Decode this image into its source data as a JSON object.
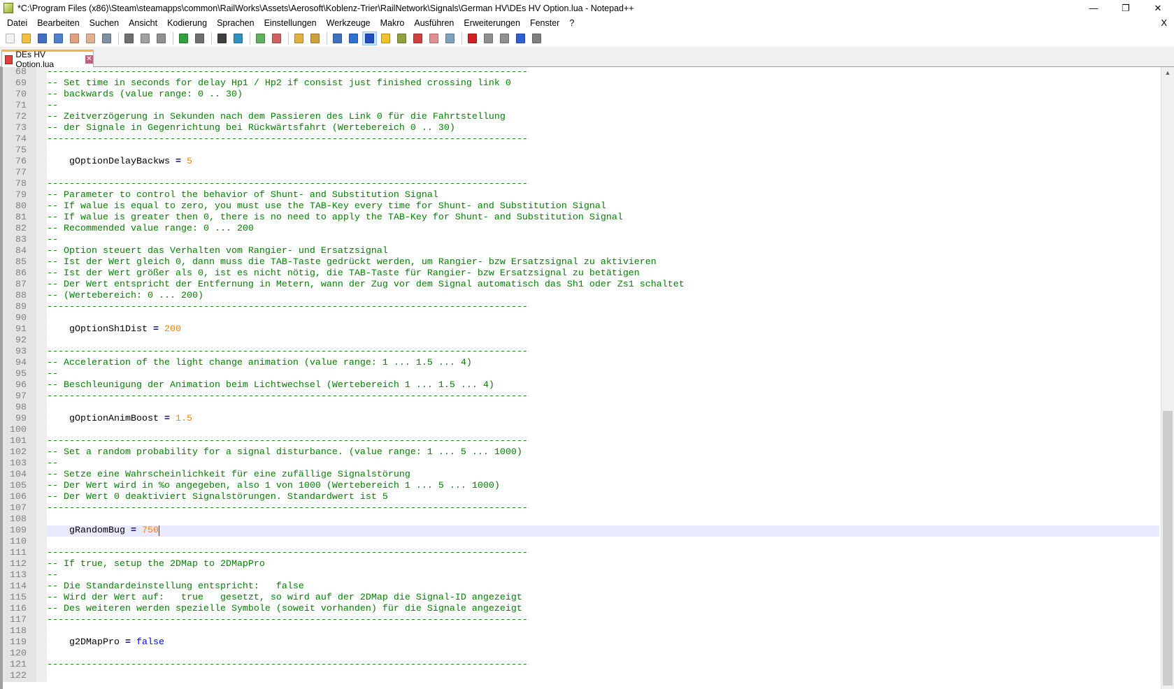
{
  "window": {
    "title": "*C:\\Program Files (x86)\\Steam\\steamapps\\common\\RailWorks\\Assets\\Aerosoft\\Koblenz-Trier\\RailNetwork\\Signals\\German HV\\DEs HV Option.lua - Notepad++",
    "minimize": "—",
    "restore": "❐",
    "close": "✕"
  },
  "menu": [
    "Datei",
    "Bearbeiten",
    "Suchen",
    "Ansicht",
    "Kodierung",
    "Sprachen",
    "Einstellungen",
    "Werkzeuge",
    "Makro",
    "Ausführen",
    "Erweiterungen",
    "Fenster",
    "?"
  ],
  "menu_close": "X",
  "toolbar": [
    {
      "icon": "new-file-icon",
      "color": "#f4f4f4"
    },
    {
      "icon": "open-file-icon",
      "color": "#f0c040"
    },
    {
      "icon": "save-icon",
      "color": "#4070c0"
    },
    {
      "icon": "save-all-icon",
      "color": "#5080d0"
    },
    {
      "icon": "close-icon",
      "color": "#e0a080"
    },
    {
      "icon": "close-all-icon",
      "color": "#e0b090"
    },
    {
      "icon": "print-icon",
      "color": "#8090a0"
    },
    {
      "sep": true
    },
    {
      "icon": "cut-icon",
      "color": "#707070"
    },
    {
      "icon": "copy-icon",
      "color": "#a0a0a0"
    },
    {
      "icon": "paste-icon",
      "color": "#909090"
    },
    {
      "sep": true
    },
    {
      "icon": "undo-icon",
      "color": "#30a040"
    },
    {
      "icon": "redo-icon",
      "color": "#707070"
    },
    {
      "sep": true
    },
    {
      "icon": "find-icon",
      "color": "#404040"
    },
    {
      "icon": "replace-icon",
      "color": "#3090c0"
    },
    {
      "sep": true
    },
    {
      "icon": "zoom-in-icon",
      "color": "#60b060"
    },
    {
      "icon": "zoom-out-icon",
      "color": "#d06060"
    },
    {
      "sep": true
    },
    {
      "icon": "sync-vertical-icon",
      "color": "#e0b040"
    },
    {
      "icon": "sync-horizontal-icon",
      "color": "#d0a040"
    },
    {
      "sep": true
    },
    {
      "icon": "word-wrap-icon",
      "color": "#4070c0"
    },
    {
      "icon": "show-all-chars-icon",
      "color": "#3070d0"
    },
    {
      "icon": "indent-guide-icon",
      "color": "#2050c0",
      "active": true
    },
    {
      "icon": "udl-icon",
      "color": "#f0c030"
    },
    {
      "icon": "doc-map-icon",
      "color": "#90a040"
    },
    {
      "icon": "function-list-icon",
      "color": "#d04040"
    },
    {
      "icon": "folder-workspace-icon",
      "color": "#e09090"
    },
    {
      "icon": "monitoring-icon",
      "color": "#80a0c0"
    },
    {
      "sep": true
    },
    {
      "icon": "record-macro-icon",
      "color": "#d02020"
    },
    {
      "icon": "stop-macro-icon",
      "color": "#909090"
    },
    {
      "icon": "play-macro-icon",
      "color": "#909090"
    },
    {
      "icon": "run-macro-multiple-icon",
      "color": "#3060d0"
    },
    {
      "icon": "save-macro-icon",
      "color": "#808080"
    }
  ],
  "tab": {
    "label": "DEs HV Option.lua",
    "close": "✕"
  },
  "colors": {
    "comment": "#008000",
    "number": "#ff8000",
    "keyword": "#0000ff",
    "current_line": "#e8e8ff"
  },
  "lines": [
    {
      "n": "68",
      "s": [
        [
          "comment",
          "--------------------------------------------------------------------------------------"
        ]
      ]
    },
    {
      "n": "69",
      "s": [
        [
          "comment",
          "-- Set time in seconds for delay Hp1 / Hp2 if consist just finished crossing link 0"
        ]
      ]
    },
    {
      "n": "70",
      "s": [
        [
          "comment",
          "-- backwards (value range: 0 .. 30)"
        ]
      ]
    },
    {
      "n": "71",
      "s": [
        [
          "comment",
          "--"
        ]
      ]
    },
    {
      "n": "72",
      "s": [
        [
          "comment",
          "-- Zeitverzögerung in Sekunden nach dem Passieren des Link 0 für die Fahrtstellung"
        ]
      ]
    },
    {
      "n": "73",
      "s": [
        [
          "comment",
          "-- der Signale in Gegenrichtung bei Rückwärtsfahrt (Wertebereich 0 .. 30)"
        ]
      ]
    },
    {
      "n": "74",
      "s": [
        [
          "comment",
          "--------------------------------------------------------------------------------------"
        ]
      ]
    },
    {
      "n": "75",
      "s": []
    },
    {
      "n": "76",
      "s": [
        [
          "plain",
          "    gOptionDelayBackws "
        ],
        [
          "op",
          "="
        ],
        [
          "plain",
          " "
        ],
        [
          "num",
          "5"
        ]
      ]
    },
    {
      "n": "77",
      "s": []
    },
    {
      "n": "78",
      "s": [
        [
          "comment",
          "--------------------------------------------------------------------------------------"
        ]
      ]
    },
    {
      "n": "79",
      "s": [
        [
          "comment",
          "-- Parameter to control the behavior of Shunt- and Substitution Signal"
        ]
      ]
    },
    {
      "n": "80",
      "s": [
        [
          "comment",
          "-- If walue is equal to zero, you must use the TAB-Key every time for Shunt- and Substitution Signal"
        ]
      ]
    },
    {
      "n": "81",
      "s": [
        [
          "comment",
          "-- If walue is greater then 0, there is no need to apply the TAB-Key for Shunt- and Substitution Signal"
        ]
      ]
    },
    {
      "n": "82",
      "s": [
        [
          "comment",
          "-- Recommended value range: 0 ... 200"
        ]
      ]
    },
    {
      "n": "83",
      "s": [
        [
          "comment",
          "--"
        ]
      ]
    },
    {
      "n": "84",
      "s": [
        [
          "comment",
          "-- Option steuert das Verhalten vom Rangier- und Ersatzsignal"
        ]
      ]
    },
    {
      "n": "85",
      "s": [
        [
          "comment",
          "-- Ist der Wert gleich 0, dann muss die TAB-Taste gedrückt werden, um Rangier- bzw Ersatzsignal zu aktivieren"
        ]
      ]
    },
    {
      "n": "86",
      "s": [
        [
          "comment",
          "-- Ist der Wert größer als 0, ist es nicht nötig, die TAB-Taste für Rangier- bzw Ersatzsignal zu betätigen"
        ]
      ]
    },
    {
      "n": "87",
      "s": [
        [
          "comment",
          "-- Der Wert entspricht der Entfernung in Metern, wann der Zug vor dem Signal automatisch das Sh1 oder Zs1 schaltet"
        ]
      ]
    },
    {
      "n": "88",
      "s": [
        [
          "comment",
          "-- (Wertebereich: 0 ... 200)"
        ]
      ]
    },
    {
      "n": "89",
      "s": [
        [
          "comment",
          "--------------------------------------------------------------------------------------"
        ]
      ]
    },
    {
      "n": "90",
      "s": []
    },
    {
      "n": "91",
      "s": [
        [
          "plain",
          "    gOptionSh1Dist "
        ],
        [
          "op",
          "="
        ],
        [
          "plain",
          " "
        ],
        [
          "num",
          "200"
        ]
      ]
    },
    {
      "n": "92",
      "s": []
    },
    {
      "n": "93",
      "s": [
        [
          "comment",
          "--------------------------------------------------------------------------------------"
        ]
      ]
    },
    {
      "n": "94",
      "s": [
        [
          "comment",
          "-- Acceleration of the light change animation (value range: 1 ... 1.5 ... 4)"
        ]
      ]
    },
    {
      "n": "95",
      "s": [
        [
          "comment",
          "--"
        ]
      ]
    },
    {
      "n": "96",
      "s": [
        [
          "comment",
          "-- Beschleunigung der Animation beim Lichtwechsel (Wertebereich 1 ... 1.5 ... 4)"
        ]
      ]
    },
    {
      "n": "97",
      "s": [
        [
          "comment",
          "--------------------------------------------------------------------------------------"
        ]
      ]
    },
    {
      "n": "98",
      "s": []
    },
    {
      "n": "99",
      "s": [
        [
          "plain",
          "    gOptionAnimBoost "
        ],
        [
          "op",
          "="
        ],
        [
          "plain",
          " "
        ],
        [
          "num",
          "1.5"
        ]
      ]
    },
    {
      "n": "100",
      "s": []
    },
    {
      "n": "101",
      "s": [
        [
          "comment",
          "--------------------------------------------------------------------------------------"
        ]
      ]
    },
    {
      "n": "102",
      "s": [
        [
          "comment",
          "-- Set a random probability for a signal disturbance. (value range: 1 ... 5 ... 1000)"
        ]
      ]
    },
    {
      "n": "103",
      "s": [
        [
          "comment",
          "--"
        ]
      ]
    },
    {
      "n": "104",
      "s": [
        [
          "comment",
          "-- Setze eine Wahrscheinlichkeit für eine zufällige Signalstörung"
        ]
      ]
    },
    {
      "n": "105",
      "s": [
        [
          "comment",
          "-- Der Wert wird in %o angegeben, also 1 von 1000 (Wertebereich 1 ... 5 ... 1000)"
        ]
      ]
    },
    {
      "n": "106",
      "s": [
        [
          "comment",
          "-- Der Wert 0 deaktiviert Signalstörungen. Standardwert ist 5"
        ]
      ]
    },
    {
      "n": "107",
      "s": [
        [
          "comment",
          "--------------------------------------------------------------------------------------"
        ]
      ]
    },
    {
      "n": "108",
      "s": []
    },
    {
      "n": "109",
      "current": true,
      "s": [
        [
          "plain",
          "    gRandomBug "
        ],
        [
          "op",
          "="
        ],
        [
          "plain",
          " "
        ],
        [
          "num",
          "750"
        ]
      ]
    },
    {
      "n": "110",
      "s": []
    },
    {
      "n": "111",
      "s": [
        [
          "comment",
          "--------------------------------------------------------------------------------------"
        ]
      ]
    },
    {
      "n": "112",
      "s": [
        [
          "comment",
          "-- If true, setup the 2DMap to 2DMapPro"
        ]
      ]
    },
    {
      "n": "113",
      "s": [
        [
          "comment",
          "--"
        ]
      ]
    },
    {
      "n": "114",
      "s": [
        [
          "comment",
          "-- Die Standardeinstellung entspricht:   false"
        ]
      ]
    },
    {
      "n": "115",
      "s": [
        [
          "comment",
          "-- Wird der Wert auf:   true   gesetzt, so wird auf der 2DMap die Signal-ID angezeigt"
        ]
      ]
    },
    {
      "n": "116",
      "s": [
        [
          "comment",
          "-- Des weiteren werden spezielle Symbole (soweit vorhanden) für die Signale angezeigt"
        ]
      ]
    },
    {
      "n": "117",
      "s": [
        [
          "comment",
          "--------------------------------------------------------------------------------------"
        ]
      ]
    },
    {
      "n": "118",
      "s": []
    },
    {
      "n": "119",
      "s": [
        [
          "plain",
          "    g2DMapPro "
        ],
        [
          "op",
          "="
        ],
        [
          "plain",
          " "
        ],
        [
          "kw",
          "false"
        ]
      ]
    },
    {
      "n": "120",
      "s": []
    },
    {
      "n": "121",
      "s": [
        [
          "comment",
          "--------------------------------------------------------------------------------------"
        ]
      ]
    },
    {
      "n": "122",
      "s": []
    }
  ],
  "scroll": {
    "position_fraction": 0.55,
    "visible_fraction": 0.45
  }
}
